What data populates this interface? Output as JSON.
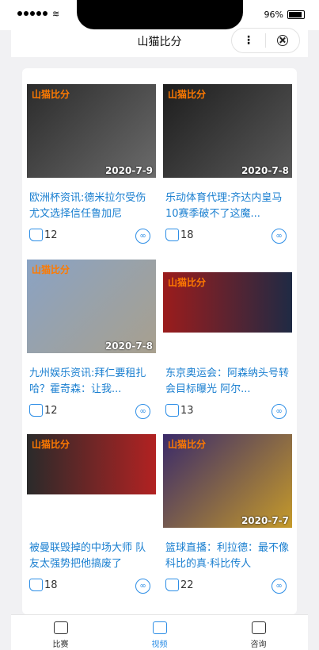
{
  "status_bar": {
    "battery": "96%"
  },
  "nav": {
    "title": "山猫比分",
    "more": "⋮"
  },
  "tabs": [
    {
      "label": "比赛",
      "icon": "trophy-icon"
    },
    {
      "label": "视频",
      "icon": "film-icon"
    },
    {
      "label": "咨询",
      "icon": "chat-icon"
    }
  ],
  "articles": [
    {
      "date": "2020-7-9",
      "title": "欧洲杯资讯:德米拉尔受伤尤文选择信任鲁加尼",
      "likes": "12"
    },
    {
      "date": "2020-7-8",
      "title": "乐动体育代理:齐达内皇马10赛季破不了这魔...",
      "likes": "18"
    },
    {
      "date": "2020-7-8",
      "title": "九州娱乐资讯:拜仁要租扎哈？霍奇森：让我...",
      "likes": "12"
    },
    {
      "date": "",
      "title": "东京奥运会：阿森纳头号转会目标曝光 阿尔...",
      "likes": "13"
    },
    {
      "date": "",
      "title": "被曼联毁掉的中场大师 队友太强势把他搞废了",
      "likes": "18"
    },
    {
      "date": "2020-7-7",
      "title": "篮球直播：利拉德：最不像科比的真·科比传人",
      "likes": "22"
    }
  ],
  "brand_logo": "山猫比分"
}
